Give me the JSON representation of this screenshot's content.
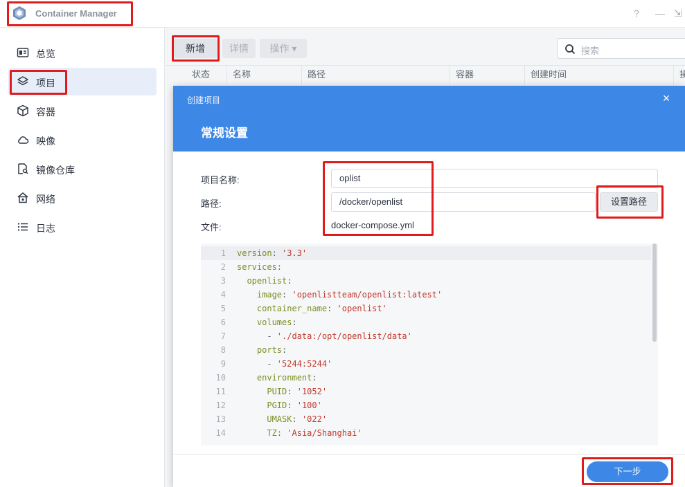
{
  "window": {
    "title": "Container Manager",
    "help": "?",
    "minimize": "—",
    "pin": "⇲"
  },
  "sidebar": {
    "items": [
      {
        "label": "总览",
        "icon": "overview-icon"
      },
      {
        "label": "项目",
        "icon": "project-layers-icon",
        "active": true
      },
      {
        "label": "容器",
        "icon": "container-box-icon"
      },
      {
        "label": "映像",
        "icon": "image-cloud-icon"
      },
      {
        "label": "镜像仓库",
        "icon": "registry-icon"
      },
      {
        "label": "网络",
        "icon": "network-icon"
      },
      {
        "label": "日志",
        "icon": "log-list-icon"
      }
    ]
  },
  "toolbar": {
    "new_label": "新增",
    "detail_label": "详情",
    "action_label": "操作 ▾",
    "search_placeholder": "搜索"
  },
  "table": {
    "columns": [
      "状态",
      "名称",
      "路径",
      "容器",
      "创建时间",
      "操"
    ]
  },
  "modal": {
    "small_title": "创建项目",
    "close": "×",
    "title": "常规设置",
    "project_name_label": "项目名称:",
    "project_name_value": "oplist",
    "path_label": "路径:",
    "path_value": "/docker/openlist",
    "set_path_label": "设置路径",
    "file_label": "文件:",
    "file_value": "docker-compose.yml",
    "next_label": "下一步"
  },
  "code": {
    "lines": [
      {
        "n": "1",
        "key": "version",
        "indent": "",
        "val": "'3.3'"
      },
      {
        "n": "2",
        "key": "services",
        "indent": "",
        "val": ""
      },
      {
        "n": "3",
        "key": "openlist",
        "indent": "  ",
        "val": ""
      },
      {
        "n": "4",
        "key": "image",
        "indent": "    ",
        "val": "'openlistteam/openlist:latest'"
      },
      {
        "n": "5",
        "key": "container_name",
        "indent": "    ",
        "val": "'openlist'"
      },
      {
        "n": "6",
        "key": "volumes",
        "indent": "    ",
        "val": ""
      },
      {
        "n": "7",
        "key": "",
        "indent": "      - ",
        "val": "'./data:/opt/openlist/data'"
      },
      {
        "n": "8",
        "key": "ports",
        "indent": "    ",
        "val": ""
      },
      {
        "n": "9",
        "key": "",
        "indent": "      - ",
        "val": "'5244:5244'"
      },
      {
        "n": "10",
        "key": "environment",
        "indent": "    ",
        "val": ""
      },
      {
        "n": "11",
        "key": "PUID",
        "indent": "      ",
        "val": "'1052'"
      },
      {
        "n": "12",
        "key": "PGID",
        "indent": "      ",
        "val": "'100'"
      },
      {
        "n": "13",
        "key": "UMASK",
        "indent": "      ",
        "val": "'022'"
      },
      {
        "n": "14",
        "key": "TZ",
        "indent": "      ",
        "val": "'Asia/Shanghai'"
      }
    ]
  },
  "colors": {
    "accent": "#3d87e6",
    "highlight": "#e01b1b",
    "yaml_key": "#7d8b1e",
    "yaml_string": "#c0392b"
  }
}
